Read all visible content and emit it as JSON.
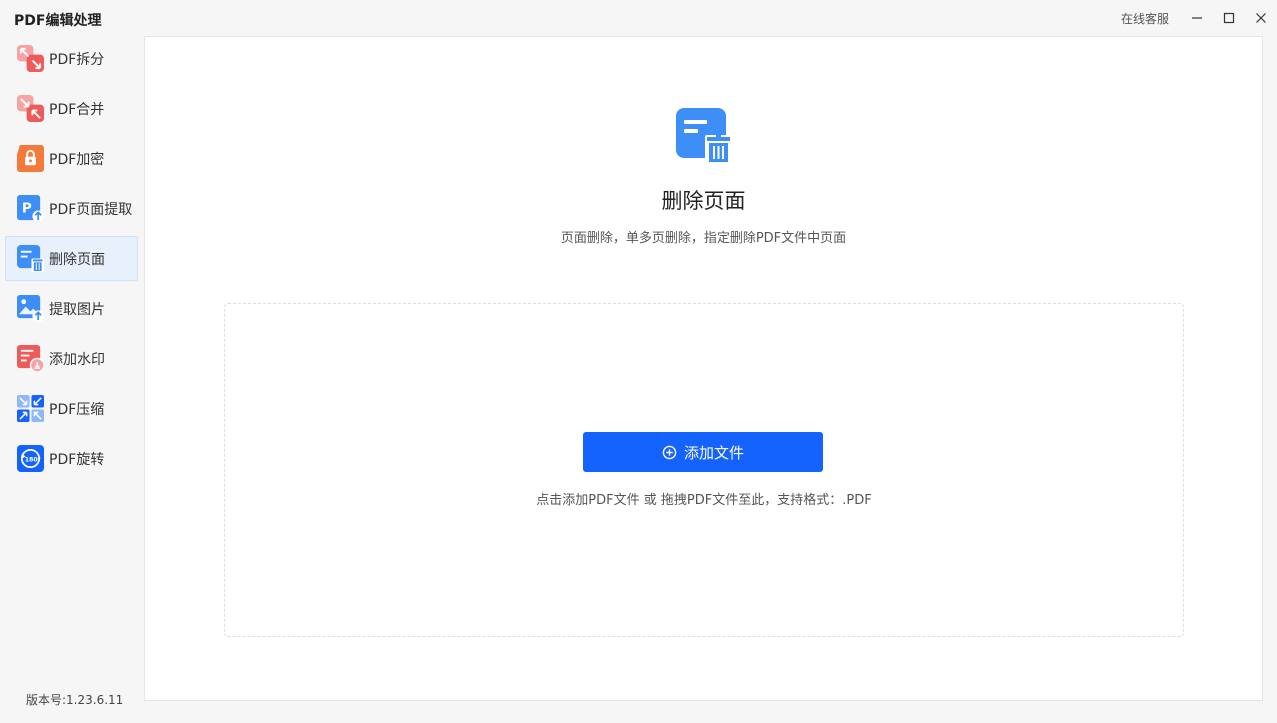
{
  "app": {
    "title": "PDF编辑处理",
    "online_service": "在线客服",
    "version": "版本号:1.23.6.11"
  },
  "window_controls": [
    {
      "name": "minimize-icon"
    },
    {
      "name": "maximize-icon"
    },
    {
      "name": "close-icon"
    }
  ],
  "sidebar": {
    "items": [
      {
        "label": "PDF拆分",
        "icon": "split-icon",
        "active": false
      },
      {
        "label": "PDF合并",
        "icon": "merge-icon",
        "active": false
      },
      {
        "label": "PDF加密",
        "icon": "lock-icon",
        "active": false
      },
      {
        "label": "PDF页面提取",
        "icon": "page-extract-icon",
        "active": false
      },
      {
        "label": "删除页面",
        "icon": "delete-page-icon",
        "active": true
      },
      {
        "label": "提取图片",
        "icon": "extract-image-icon",
        "active": false
      },
      {
        "label": "添加水印",
        "icon": "watermark-icon",
        "active": false
      },
      {
        "label": "PDF压缩",
        "icon": "compress-icon",
        "active": false
      },
      {
        "label": "PDF旋转",
        "icon": "rotate-icon",
        "active": false
      }
    ]
  },
  "main": {
    "heading": "删除页面",
    "description": "页面删除，单多页删除，指定删除PDF文件中页面",
    "add_button": "添加文件",
    "drop_hint": "点击添加PDF文件 或 拖拽PDF文件至此，支持格式：.PDF"
  },
  "colors": {
    "accent": "#1463ff",
    "red_icon": "#ef5a5a",
    "orange_icon": "#f47a3c",
    "blue_icon": "#3d8ef7",
    "active_bg": "#e8f0fc"
  }
}
